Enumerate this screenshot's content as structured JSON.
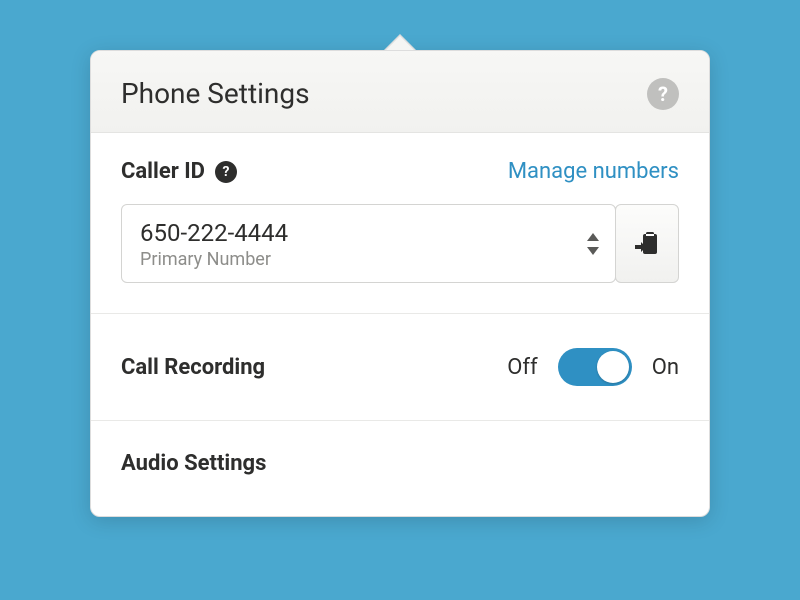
{
  "header": {
    "title": "Phone Settings"
  },
  "caller_id": {
    "label": "Caller ID",
    "manage_link": "Manage numbers",
    "number": "650-222-4444",
    "sub": "Primary Number"
  },
  "call_recording": {
    "label": "Call Recording",
    "off": "Off",
    "on": "On",
    "state": "on"
  },
  "audio": {
    "label": "Audio Settings"
  },
  "colors": {
    "background": "#4aa8cf",
    "accent": "#2f90c3"
  }
}
